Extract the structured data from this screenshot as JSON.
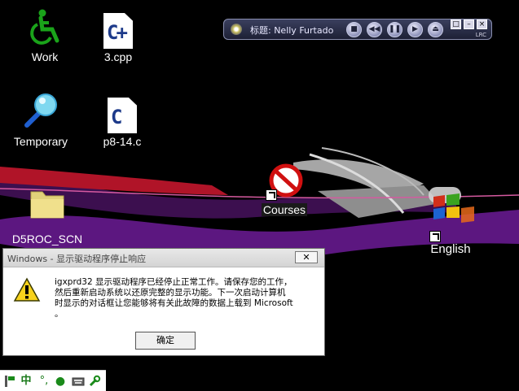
{
  "desktop": {
    "icons": [
      {
        "label": "Work",
        "glyph": "accessibility-icon"
      },
      {
        "label": "3.cpp",
        "glyph": "C+"
      },
      {
        "label": "Temporary",
        "glyph": "magnifier-icon"
      },
      {
        "label": "p8-14.c",
        "glyph": "C"
      },
      {
        "label": "D5ROC_SCN",
        "glyph": "folder-icon"
      },
      {
        "label": "Courses",
        "glyph": "no-entry-icon"
      },
      {
        "label": "English",
        "glyph": "windows-logo-icon"
      }
    ]
  },
  "player": {
    "title": "标题: Nelly Furtado",
    "buttons": [
      "■",
      "◀◀",
      "❚❚",
      "▶",
      "⏏"
    ],
    "window_buttons": [
      "□",
      "–",
      "×"
    ],
    "lrc_label": "LRC"
  },
  "dialog": {
    "title": "Windows - 显示驱动程序停止响应",
    "close_label": "✕",
    "message_lines": [
      "igxprd32 显示驱动程序已经停止正常工作。请保存您的工作，",
      "然后重新启动系统以还原完整的显示功能。下一次启动计算机",
      "时显示的对话框让您能够将有关此故障的数据上载到 Microsoft",
      "。"
    ],
    "ok_label": "确定"
  },
  "tray": {
    "icons": [
      "ime-toggle-icon",
      "中",
      "°,",
      "●",
      "keyboard-icon",
      "wrench-icon"
    ]
  },
  "colors": {
    "desktop_bg": "#000000",
    "wallpaper_purple": "#6a1b8a",
    "wallpaper_red": "#c0152b",
    "wallpaper_gray": "#9a9a9a",
    "dialog_bg": "#ffffff"
  }
}
